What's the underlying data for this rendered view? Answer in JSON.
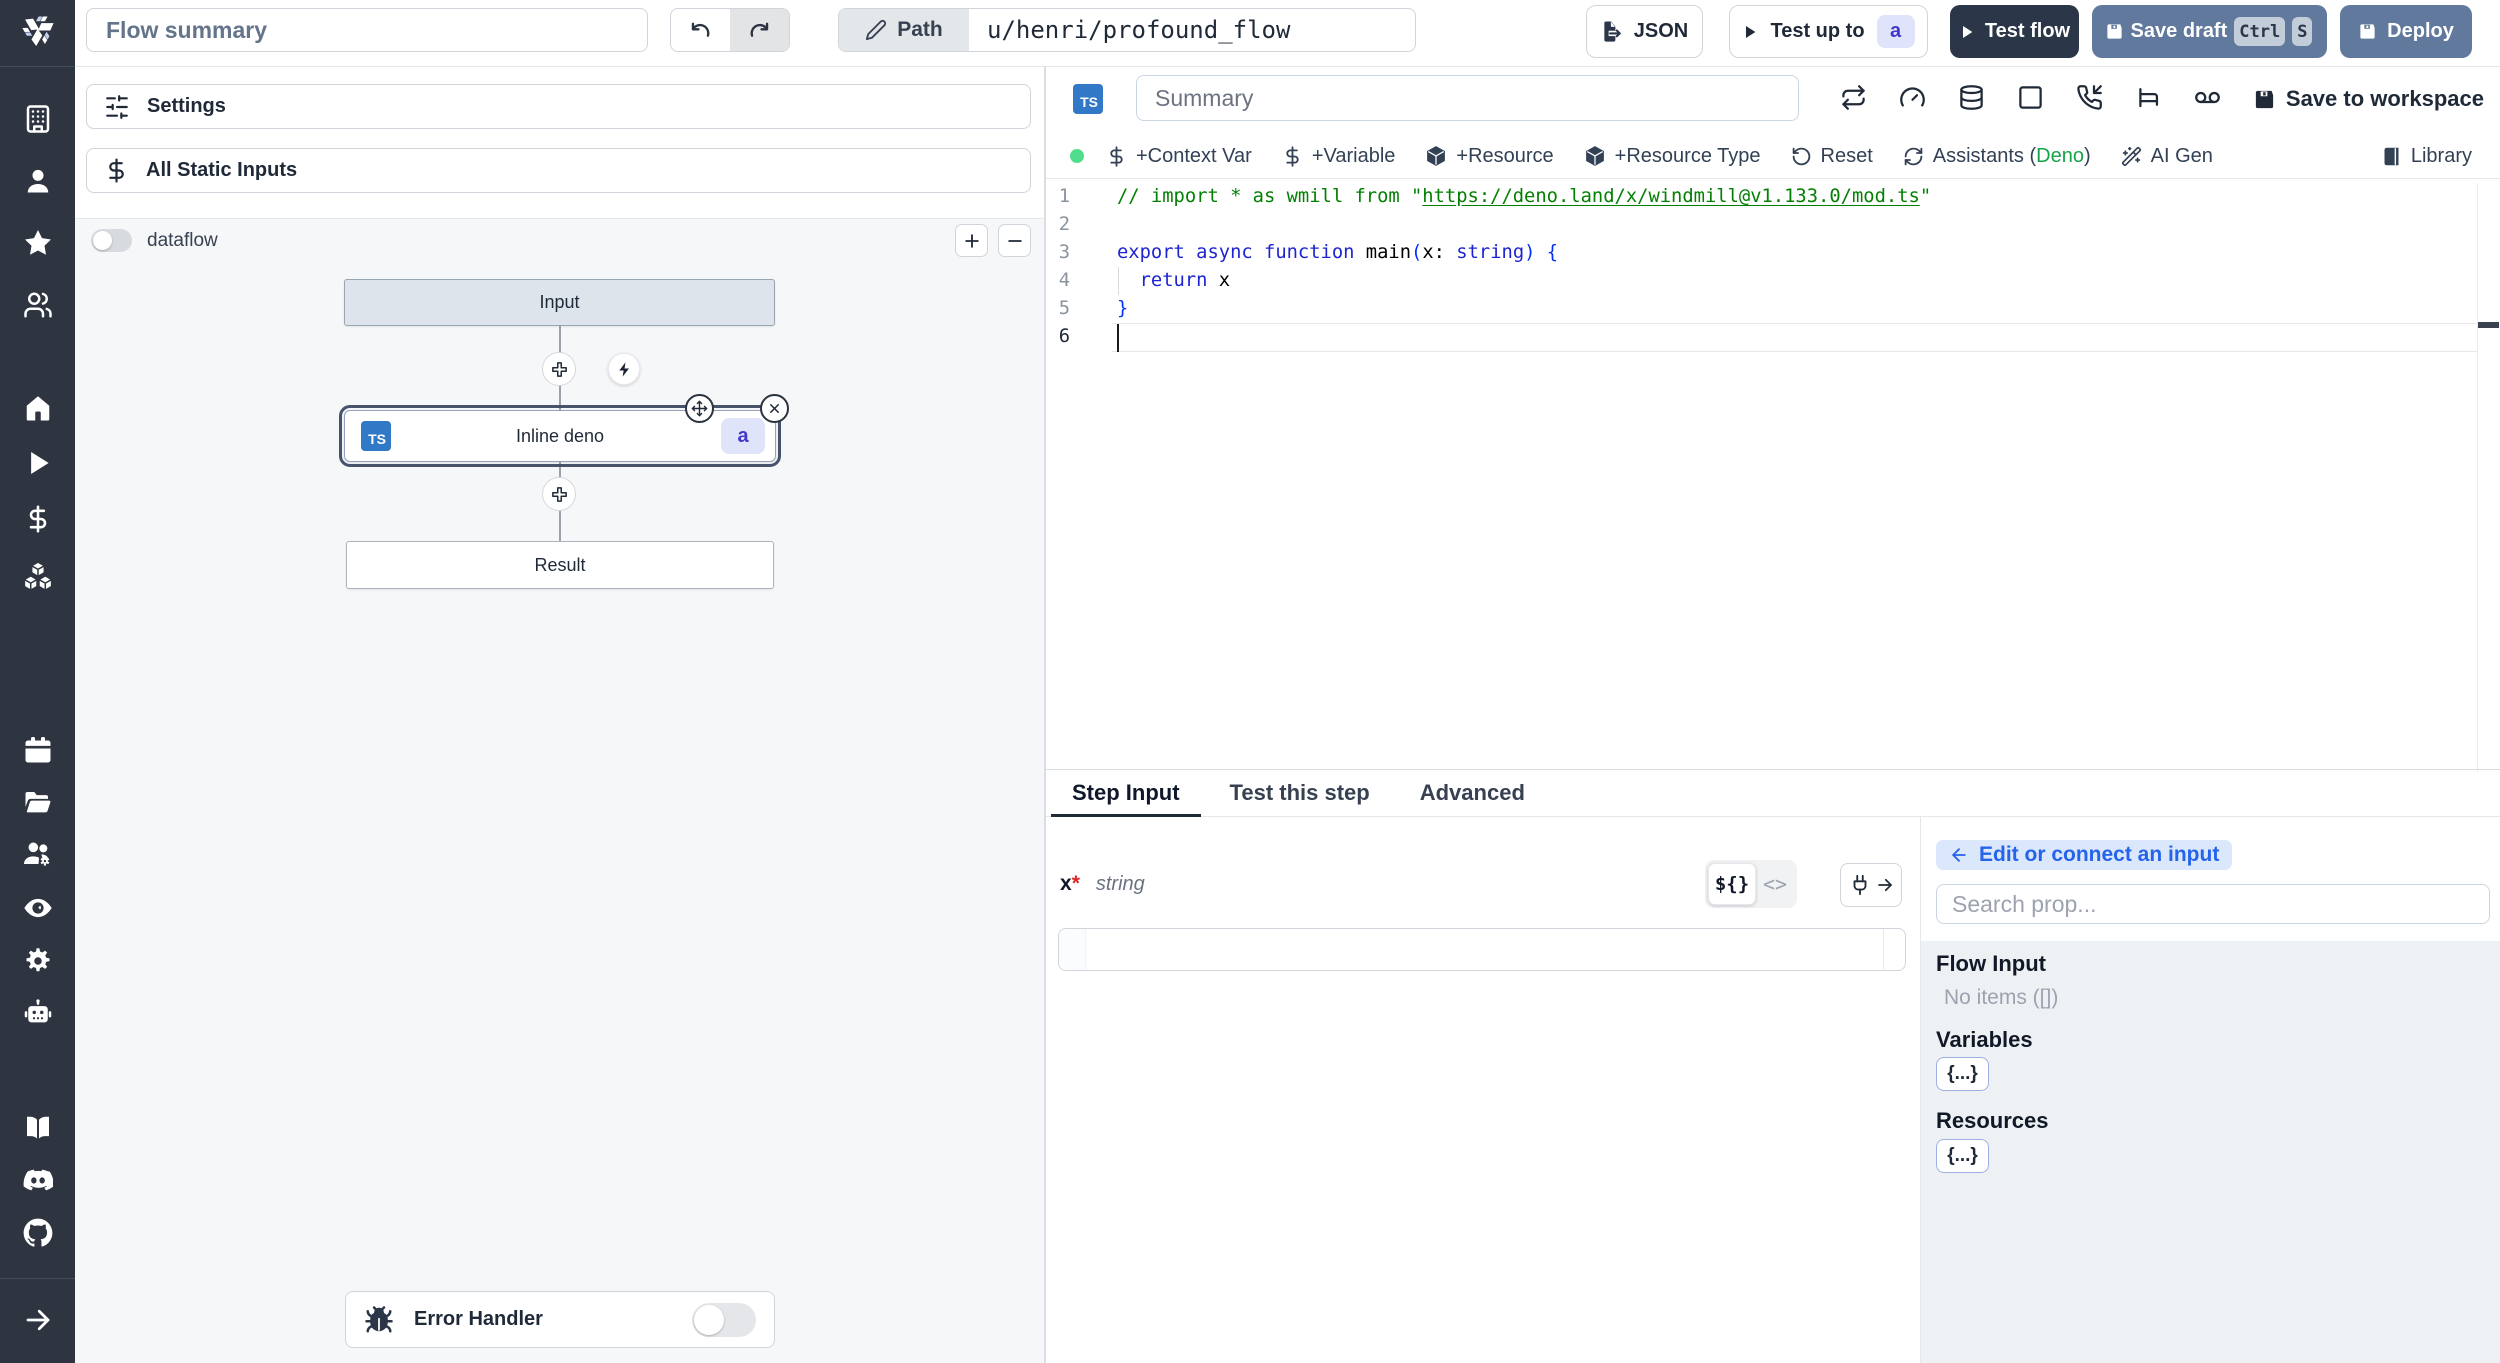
{
  "topbar": {
    "flow_summary_placeholder": "Flow summary",
    "path_label": "Path",
    "path_value": "u/henri/profound_flow",
    "json_label": "JSON",
    "test_up_to_label": "Test up to",
    "test_up_to_badge": "a",
    "test_flow_label": "Test flow",
    "save_draft_label": "Save draft",
    "kbd_ctrl": "Ctrl",
    "kbd_s": "S",
    "deploy_label": "Deploy"
  },
  "left_panel": {
    "settings_label": "Settings",
    "static_inputs_label": "All Static Inputs",
    "dataflow_label": "dataflow",
    "graph": {
      "input_node": "Input",
      "step_node": "Inline deno",
      "step_lang": "TS",
      "step_badge": "a",
      "result_node": "Result"
    },
    "error_handler_label": "Error Handler"
  },
  "editor": {
    "lang_badge": "TS",
    "summary_placeholder": "Summary",
    "save_to_workspace": "Save to workspace",
    "toolbar": {
      "context_var": "+Context Var",
      "variable": "+Variable",
      "resource": "+Resource",
      "resource_type": "+Resource Type",
      "reset": "Reset",
      "assistants_pre": "Assistants (",
      "assistants_lang": "Deno",
      "assistants_post": ")",
      "ai_gen": "AI Gen",
      "library": "Library"
    },
    "code": {
      "lines": [
        {
          "n": "1",
          "tokens": [
            {
              "c": "comment",
              "t": "// import * as wmill from \""
            },
            {
              "c": "link",
              "t": "https://deno.land/x/windmill@v1.133.0/mod.ts"
            },
            {
              "c": "comment",
              "t": "\""
            }
          ]
        },
        {
          "n": "2",
          "tokens": []
        },
        {
          "n": "3",
          "tokens": [
            {
              "c": "kw",
              "t": "export"
            },
            {
              "c": "plain",
              "t": " "
            },
            {
              "c": "kw",
              "t": "async"
            },
            {
              "c": "plain",
              "t": " "
            },
            {
              "c": "kw",
              "t": "function"
            },
            {
              "c": "plain",
              "t": " main"
            },
            {
              "c": "bracket",
              "t": "("
            },
            {
              "c": "plain",
              "t": "x"
            },
            {
              "c": "plain",
              "t": ": "
            },
            {
              "c": "kw",
              "t": "string"
            },
            {
              "c": "bracket",
              "t": ")"
            },
            {
              "c": "plain",
              "t": " "
            },
            {
              "c": "bracket",
              "t": "{"
            }
          ]
        },
        {
          "n": "4",
          "tokens": [
            {
              "c": "plain",
              "t": "  "
            },
            {
              "c": "kw",
              "t": "return"
            },
            {
              "c": "plain",
              "t": " x"
            }
          ]
        },
        {
          "n": "5",
          "tokens": [
            {
              "c": "bracket",
              "t": "}"
            }
          ]
        },
        {
          "n": "6",
          "tokens": []
        }
      ],
      "active_line": 6
    }
  },
  "tabs": {
    "step_input": "Step Input",
    "test_this_step": "Test this step",
    "advanced": "Advanced"
  },
  "step_input": {
    "arg_name": "x",
    "arg_required": "*",
    "arg_type": "string",
    "toggle_template": "${}",
    "toggle_js": "<>"
  },
  "theme": {
    "sidebar_bg": "#2e3440",
    "primary_button_bg": "#60799c",
    "dark_button_bg": "#2b3648",
    "step_badge_bg": "#e0e4fa",
    "step_badge_text": "#4338ca",
    "link_pill_bg": "#dbe7fb",
    "link_pill_text": "#2563eb",
    "status_dot": "#52dd8c",
    "deno_green": "#16a34a",
    "code_comment_green": "#038003",
    "code_keyword_blue": "#1e24d2",
    "code_bracket_blue": "#0431fa",
    "typescript_badge_bg": "#3178c6",
    "graph_bg": "#f5f7f9",
    "panel_gray_bg": "#eef1f4"
  },
  "connect_panel": {
    "edit_connect_label": "Edit or connect an input",
    "search_placeholder": "Search prop...",
    "flow_input_title": "Flow Input",
    "flow_input_empty": "No items ([])",
    "variables_title": "Variables",
    "variables_chip": "{...}",
    "resources_title": "Resources",
    "resources_chip": "{...}"
  }
}
